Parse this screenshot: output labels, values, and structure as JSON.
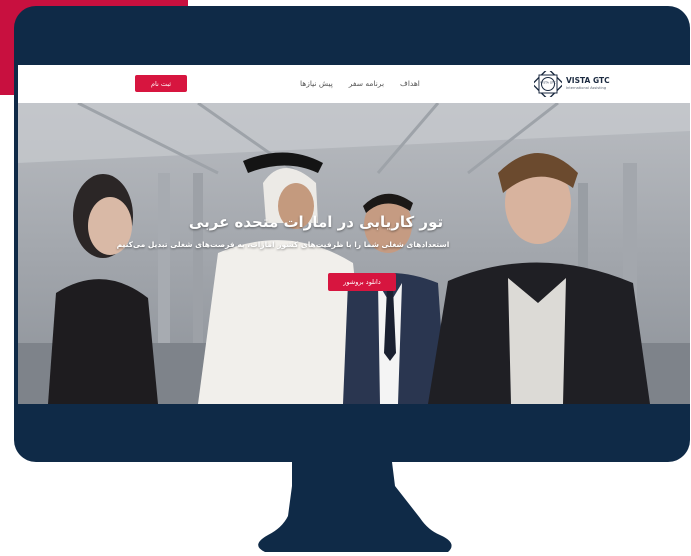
{
  "colors": {
    "accent": "#c8103f",
    "monitor": "#0f2a47",
    "button": "#d7153f"
  },
  "logo": {
    "name": "VISTA GTC",
    "subtitle": "International Assisting",
    "emblem_text": "VISTA GTC"
  },
  "nav": {
    "items": [
      "اهداف",
      "برنامه سفر",
      "پیش نیازها"
    ]
  },
  "header": {
    "register_label": "ثبت نام"
  },
  "hero": {
    "title": "تور کاریابی در امارات متحده عربی",
    "subtitle": "استعدادهای شغلی شما را با ظرفیت‌های کشور امارات، به فرصت‌های شغلی تبدیل می‌کنیم",
    "button_label": "دانلود بروشور"
  }
}
